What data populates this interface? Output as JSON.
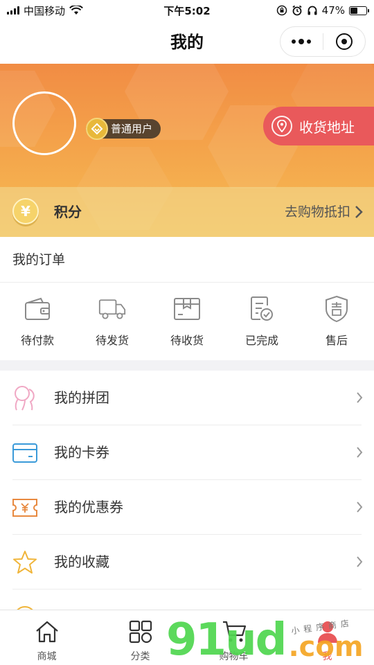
{
  "status_bar": {
    "carrier": "中国移动",
    "time": "下午5:02",
    "battery_text": "47%",
    "battery_level": 0.47
  },
  "nav": {
    "title": "我的",
    "more_icon": "more-dots-icon",
    "close_icon": "target-circle-icon"
  },
  "profile": {
    "member_level": "普通用户",
    "address_button": "收货地址"
  },
  "points": {
    "coin_symbol": "¥",
    "label": "积分",
    "action": "去购物抵扣"
  },
  "orders": {
    "header": "我的订单",
    "items": [
      {
        "label": "待付款",
        "icon": "wallet-icon"
      },
      {
        "label": "待发货",
        "icon": "truck-icon"
      },
      {
        "label": "待收货",
        "icon": "package-icon"
      },
      {
        "label": "已完成",
        "icon": "checklist-icon"
      },
      {
        "label": "售后",
        "icon": "shield-icon"
      }
    ]
  },
  "menu": [
    {
      "label": "我的拼团",
      "icon": "group-icon"
    },
    {
      "label": "我的卡券",
      "icon": "card-icon"
    },
    {
      "label": "我的优惠券",
      "icon": "coupon-icon"
    },
    {
      "label": "我的收藏",
      "icon": "star-icon"
    }
  ],
  "tabbar": [
    {
      "label": "商城",
      "icon": "home-icon"
    },
    {
      "label": "分类",
      "icon": "category-icon"
    },
    {
      "label": "购物车",
      "icon": "cart-icon"
    },
    {
      "label": "我",
      "icon": "user-icon",
      "active": true
    }
  ],
  "watermark": {
    "main": "91ud",
    "suffix": ".com",
    "small": "小程序商店"
  },
  "colors": {
    "accent": "#e9595b",
    "hero_top": "#f18c44",
    "hero_bottom": "#f6bd54"
  }
}
